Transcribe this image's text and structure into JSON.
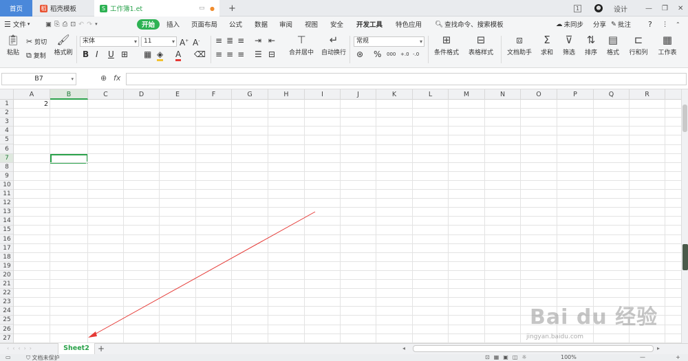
{
  "titlebar": {
    "tabs": [
      {
        "label": "首页"
      },
      {
        "label": "稻壳模板"
      },
      {
        "label": "工作簿1.et"
      }
    ],
    "new_tab": "+",
    "page_badge": "1",
    "design": "设计",
    "win_min": "—",
    "win_max": "❐",
    "win_close": "✕"
  },
  "menubar": {
    "file": "文件",
    "items": [
      "开始",
      "插入",
      "页面布局",
      "公式",
      "数据",
      "审阅",
      "视图",
      "安全",
      "开发工具",
      "特色应用"
    ],
    "search": "查找命令、搜索模板",
    "sync": "未同步",
    "share": "分享",
    "comment": "批注",
    "help": "?"
  },
  "ribbon": {
    "paste": "粘贴",
    "cut": "剪切",
    "copy": "复制",
    "format_painter": "格式刷",
    "font_name": "宋体",
    "font_size": "11",
    "bold": "B",
    "italic": "I",
    "underline": "U",
    "merge": "合并居中",
    "wrap": "自动换行",
    "number_format": "常规",
    "percent": "%",
    "thousands": "000",
    "cond_format": "条件格式",
    "table_style": "表格样式",
    "doc_assist": "文档助手",
    "sum": "求和",
    "filter": "筛选",
    "sort": "排序",
    "format": "格式",
    "rowcol": "行和列",
    "worksheet": "工作表"
  },
  "formula_bar": {
    "cell_ref": "B7",
    "fx": "fx",
    "value": ""
  },
  "grid": {
    "columns": [
      "A",
      "B",
      "C",
      "D",
      "E",
      "F",
      "G",
      "H",
      "I",
      "J",
      "K",
      "L",
      "M",
      "N",
      "O",
      "P",
      "Q",
      "R"
    ],
    "rows": [
      "1",
      "2",
      "3",
      "4",
      "5",
      "6",
      "7",
      "8",
      "9",
      "10",
      "11",
      "12",
      "13",
      "14",
      "15",
      "16",
      "17",
      "18",
      "19",
      "20",
      "21",
      "22",
      "23",
      "24",
      "25",
      "26",
      "27"
    ],
    "cells": {
      "A1": "2"
    },
    "selected_cell": "B7"
  },
  "sheets": {
    "tabs": [
      "Sheet2"
    ],
    "add": "+"
  },
  "status": {
    "doc_protect": "文档未保护",
    "zoom": "100%"
  },
  "watermark": {
    "brand": "Bai du 经验",
    "url": "jingyan.baidu.com"
  },
  "colors": {
    "accent": "#2aa24a",
    "home_tab": "#4a88da",
    "arrow": "#e53935"
  }
}
